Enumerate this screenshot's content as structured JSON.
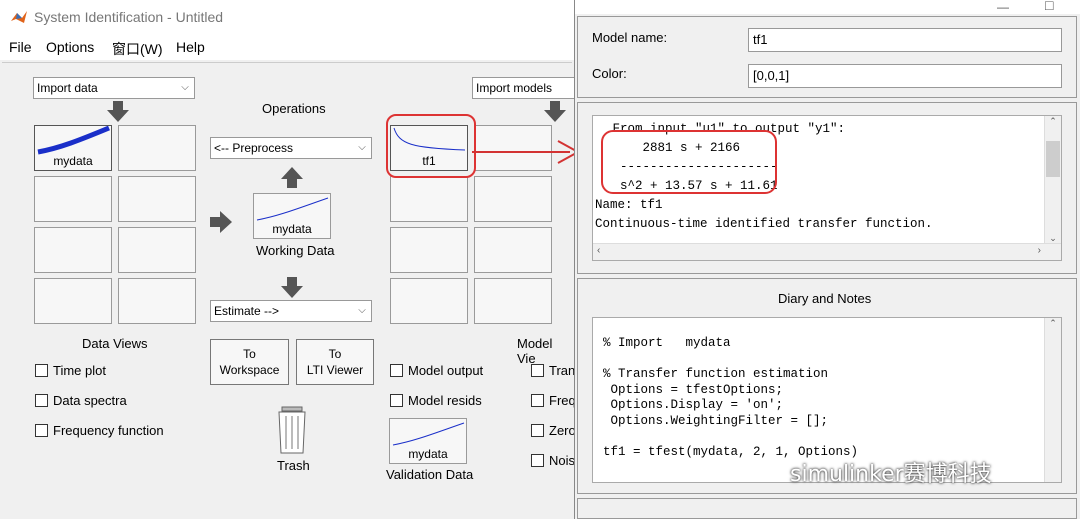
{
  "main_window": {
    "title": "System Identification - Untitled",
    "menu": [
      "File",
      "Options",
      "窗口(W)",
      "Help"
    ],
    "import_data": "Import data",
    "import_models": "Import models",
    "operations_label": "Operations",
    "preprocess": "<-- Preprocess",
    "estimate": "Estimate -->",
    "data_slot_label": "mydata",
    "working_data_slot": "mydata",
    "working_data_label": "Working Data",
    "model_slot_label": "tf1",
    "validation_slot": "mydata",
    "validation_label": "Validation Data",
    "to_workspace": [
      "To",
      "Workspace"
    ],
    "to_lti": [
      "To",
      "LTI Viewer"
    ],
    "trash_label": "Trash",
    "data_views_label": "Data Views",
    "data_views": [
      "Time plot",
      "Data spectra",
      "Frequency function"
    ],
    "model_views_label": "Model Vie",
    "model_views_left": [
      "Model output",
      "Model resids"
    ],
    "model_views_right": [
      "Tran",
      "Freq",
      "Zero",
      "Nois"
    ]
  },
  "dialog": {
    "model_name_label": "Model name:",
    "model_name_value": "tf1",
    "color_label": "Color:",
    "color_value": "[0,0,1]",
    "info_lines": [
      " From input \"u1\" to output \"y1\":",
      "     2881 s + 2166",
      "  ---------------------",
      "  s^2 + 13.57 s + 11.61",
      "Name: tf1",
      "Continuous-time identified transfer function."
    ],
    "diary_title": "Diary and Notes",
    "diary_lines": [
      "% Import   mydata",
      "",
      "% Transfer function estimation",
      " Options = tfestOptions;",
      " Options.Display = 'on';",
      " Options.WeightingFilter = [];",
      "",
      "tf1 = tfest(mydata, 2, 1, Options)"
    ]
  },
  "watermark": "simulinker赛博科技",
  "colors": {
    "annotation_red": "#d33333",
    "plot_blue": "#1a2fc9"
  }
}
